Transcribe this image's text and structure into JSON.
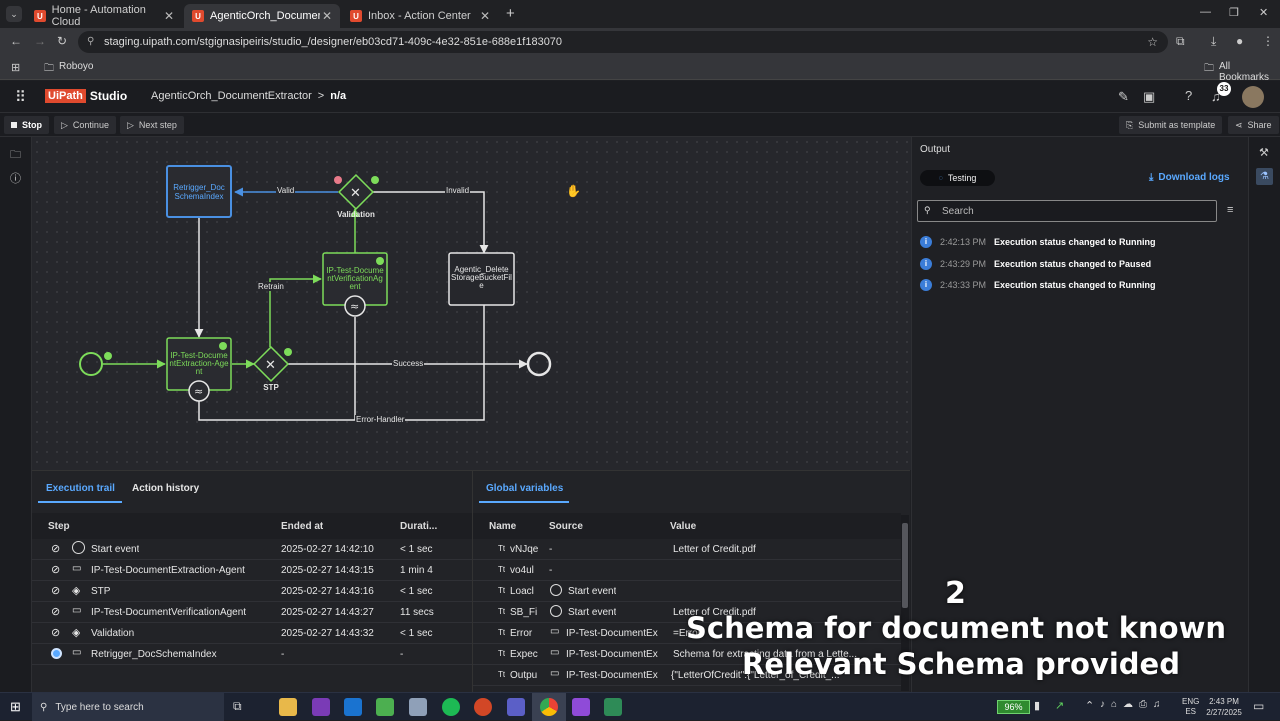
{
  "browser": {
    "tabs": [
      {
        "label": "Home - Automation Cloud"
      },
      {
        "label": "AgenticOrch_DocumentExtractor"
      },
      {
        "label": "Inbox - Action Center"
      }
    ],
    "url": "staging.uipath.com/stgignasipeiris/studio_/designer/eb03cd71-409c-4e32-851e-688e1f183070",
    "bookmark_folder": "Roboyo",
    "all_bookmarks": "All Bookmarks"
  },
  "app": {
    "brand": "Studio",
    "logo_text": "UiPath",
    "breadcrumb_project": "AgenticOrch_DocumentExtractor",
    "breadcrumb_sep": ">",
    "breadcrumb_current": "n/a",
    "notification_count": "33"
  },
  "toolbar": {
    "stop": "Stop",
    "continue": "Continue",
    "next_step": "Next step",
    "submit_template": "Submit as template",
    "share": "Share"
  },
  "diagram": {
    "nodes": {
      "retrigger": "Retrigger_Doc SchemaIndex",
      "validation": "Validation",
      "verification": "IP-Test-DocumentVerificationAgent",
      "delete": "Agentic_Delete StorageBucketFile",
      "extraction": "IP-Test-DocumentExtraction-Agent",
      "stp": "STP"
    },
    "edges": {
      "valid": "Valid",
      "invalid": "Invalid",
      "retrain": "Retrain",
      "success": "Success",
      "error": "Error-Handler"
    }
  },
  "trail": {
    "tabs": [
      "Execution trail",
      "Action history"
    ],
    "headers": [
      "Step",
      "Ended at",
      "Durati..."
    ],
    "rows": [
      {
        "step": "Start event",
        "ended": "2025-02-27 14:42:10",
        "dur": "< 1 sec"
      },
      {
        "step": "IP-Test-DocumentExtraction-Agent",
        "ended": "2025-02-27 14:43:15",
        "dur": "1 min 4"
      },
      {
        "step": "STP",
        "ended": "2025-02-27 14:43:16",
        "dur": "< 1 sec"
      },
      {
        "step": "IP-Test-DocumentVerificationAgent",
        "ended": "2025-02-27 14:43:27",
        "dur": "11 secs"
      },
      {
        "step": "Validation",
        "ended": "2025-02-27 14:43:32",
        "dur": "< 1 sec"
      },
      {
        "step": "Retrigger_DocSchemaIndex",
        "ended": "-",
        "dur": "-"
      }
    ]
  },
  "vars": {
    "tab": "Global variables",
    "headers": [
      "Name",
      "Source",
      "Value"
    ],
    "rows": [
      {
        "type": "Tt",
        "name": "vNJqe",
        "source": "-",
        "value": "Letter of Credit.pdf"
      },
      {
        "type": "Tt",
        "name": "vo4ul",
        "source": "-",
        "value": ""
      },
      {
        "type": "Tt",
        "name": "Loacl",
        "source": "Start event",
        "value": ""
      },
      {
        "type": "Tt",
        "name": "SB_Fi",
        "source": "Start event",
        "value": "Letter of Credit.pdf"
      },
      {
        "type": "Tt",
        "name": "Error",
        "source": "IP-Test-DocumentEx",
        "value": "=Error"
      },
      {
        "type": "Tt",
        "name": "Expec",
        "source": "IP-Test-DocumentEx",
        "value": "Schema for extracting data from a Lette..."
      },
      {
        "type": "Tt",
        "name": "Outpu",
        "source": "IP-Test-DocumentEx",
        "value": "{\"LetterOfCredit\":{\"Letter_of_Credit_..."
      }
    ]
  },
  "output": {
    "title": "Output",
    "status": "Testing",
    "download": "Download logs",
    "search_placeholder": "Search",
    "logs": [
      {
        "time": "2:42:13 PM",
        "msg": "Execution status changed to Running"
      },
      {
        "time": "2:43:29 PM",
        "msg": "Execution status changed to Paused"
      },
      {
        "time": "2:43:33 PM",
        "msg": "Execution status changed to Running"
      }
    ]
  },
  "overlay": {
    "number": "2",
    "line1": "Schema for document not known",
    "line2": "Relevant Schema provided"
  },
  "taskbar": {
    "search_placeholder": "Type here to search",
    "battery": "96%",
    "lang1": "ENG",
    "lang2": "ES",
    "time": "2:43 PM",
    "date": "2/27/2025"
  },
  "colors": {
    "accent": "#5aa9ff",
    "green": "#7ddc5a",
    "brand": "#e04a2e",
    "selected": "#4a90e2"
  }
}
